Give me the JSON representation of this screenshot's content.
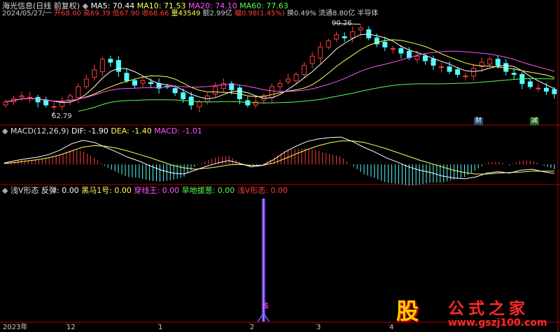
{
  "header": {
    "stock_name": "海光信息(日线 前复权)",
    "ma5": "MA5: 70.44",
    "ma10": "MA10: 71.53",
    "ma20": "MA20: 74.10",
    "ma60": "MA60: 77.63",
    "date": "2024/05/27/一",
    "open": "开68.00",
    "high": "高69.39",
    "low": "低67.90",
    "close": "收68.66",
    "volume": "量43549",
    "amount": "额2.99亿",
    "change": "幅0.98(1.45%)",
    "turnover": "换0.49%",
    "float": "流通8.80亿",
    "sector": "半导体"
  },
  "annotations": {
    "high_label": "90.26",
    "low_label": "62.79",
    "badge_cai": "财",
    "badge_jian": "减"
  },
  "macd_header": {
    "title": "MACD(12,26,9)",
    "dif": "DIF: -1.90",
    "dea": "DEA: -1.40",
    "macd": "MACD: -1.01"
  },
  "indicator_header": {
    "title": "浅V形态",
    "fantan": "反弹: 0.00",
    "heima": "黑马1号: 0.00",
    "chuanxian": "穿线王: 0.00",
    "handi": "旱地拔葱: 0.00",
    "qianv": "浅V形态: 0.00",
    "signal_label": "浅"
  },
  "time_axis": {
    "labels": [
      "2023年",
      "12",
      "1",
      "2",
      "3",
      "4"
    ]
  },
  "watermark": {
    "glyph": "股",
    "brand": "公式之家",
    "url": "www.gszj100.com"
  },
  "colors": {
    "up": "#ff3c3c",
    "down": "#54ffff",
    "ma5": "#ffffff",
    "ma10": "#ffff54",
    "ma20": "#ff54ff",
    "ma60": "#54ff54",
    "axis": "#b00000"
  },
  "chart_data": [
    {
      "type": "candlestick",
      "title": "海光信息(日线 前复权)",
      "series": [
        {
          "name": "MA5",
          "last": 70.44
        },
        {
          "name": "MA10",
          "last": 71.53
        },
        {
          "name": "MA20",
          "last": 74.1
        },
        {
          "name": "MA60",
          "last": 77.63
        }
      ],
      "close_path": [
        66,
        67,
        68,
        67.5,
        66,
        65,
        64.5,
        66,
        68,
        71,
        73.5,
        76.5,
        80,
        79,
        76,
        73,
        71.5,
        73,
        72,
        70.5,
        71,
        69,
        67,
        65,
        66,
        68,
        71,
        72,
        70,
        67,
        65,
        66,
        68,
        71,
        72,
        73.5,
        75,
        78,
        81,
        84,
        86,
        88,
        87,
        89,
        90.26,
        87,
        85,
        84,
        83.5,
        82,
        80.5,
        81,
        79.5,
        78,
        77.5,
        76,
        75,
        74.5,
        77,
        79,
        80,
        78,
        76,
        75,
        72,
        71,
        70.5,
        69.5,
        68.66
      ],
      "ohlc_last": {
        "open": 68.0,
        "high": 69.39,
        "low": 67.9,
        "close": 68.66
      },
      "marked_high": 90.26,
      "marked_low": 62.79
    },
    {
      "type": "bar",
      "title": "MACD(12,26,9)",
      "series": [
        {
          "name": "DIF",
          "last": -1.9
        },
        {
          "name": "DEA",
          "last": -1.4
        },
        {
          "name": "MACD",
          "last": -1.01
        }
      ],
      "dif": [
        0.3,
        0.8,
        1.2,
        1.5,
        2.1,
        3.0,
        4.3,
        5.0,
        4.6,
        3.6,
        2.6,
        1.5,
        0.7,
        -0.3,
        -1.2,
        -1.8,
        -2.0,
        -1.2,
        -0.4,
        0.3,
        0.8,
        0.2,
        -0.5,
        -0.2,
        1.0,
        2.6,
        3.8,
        4.8,
        5.3,
        5.6,
        5.7,
        4.8,
        3.6,
        2.6,
        1.4,
        0.5,
        -0.5,
        -1.2,
        -1.7,
        -2.4,
        -2.8,
        -3.0,
        -2.6,
        -1.8,
        -1.5,
        -1.8,
        -1.2,
        -1.0,
        -1.5,
        -1.9
      ],
      "dea": [
        0.2,
        0.4,
        0.7,
        1.0,
        1.4,
        2.0,
        2.8,
        3.6,
        3.9,
        3.8,
        3.4,
        2.8,
        2.1,
        1.4,
        0.6,
        -0.2,
        -0.7,
        -1.0,
        -0.8,
        -0.5,
        -0.1,
        0.0,
        -0.2,
        -0.2,
        0.3,
        1.2,
        2.2,
        3.1,
        3.9,
        4.5,
        4.9,
        4.9,
        4.6,
        4.0,
        3.3,
        2.5,
        1.7,
        0.9,
        0.2,
        -0.5,
        -1.2,
        -1.7,
        -2.0,
        -2.0,
        -1.8,
        -1.7,
        -1.6,
        -1.4,
        -1.4,
        -1.4
      ]
    },
    {
      "type": "bar",
      "title": "浅V形态",
      "series": [
        {
          "name": "反弹",
          "last": 0.0
        },
        {
          "name": "黑马1号",
          "last": 0.0
        },
        {
          "name": "穿线王",
          "last": 0.0
        },
        {
          "name": "旱地拔葱",
          "last": 0.0
        },
        {
          "name": "浅V形态",
          "last": 0.0
        }
      ],
      "signal_index": 0.47
    }
  ]
}
